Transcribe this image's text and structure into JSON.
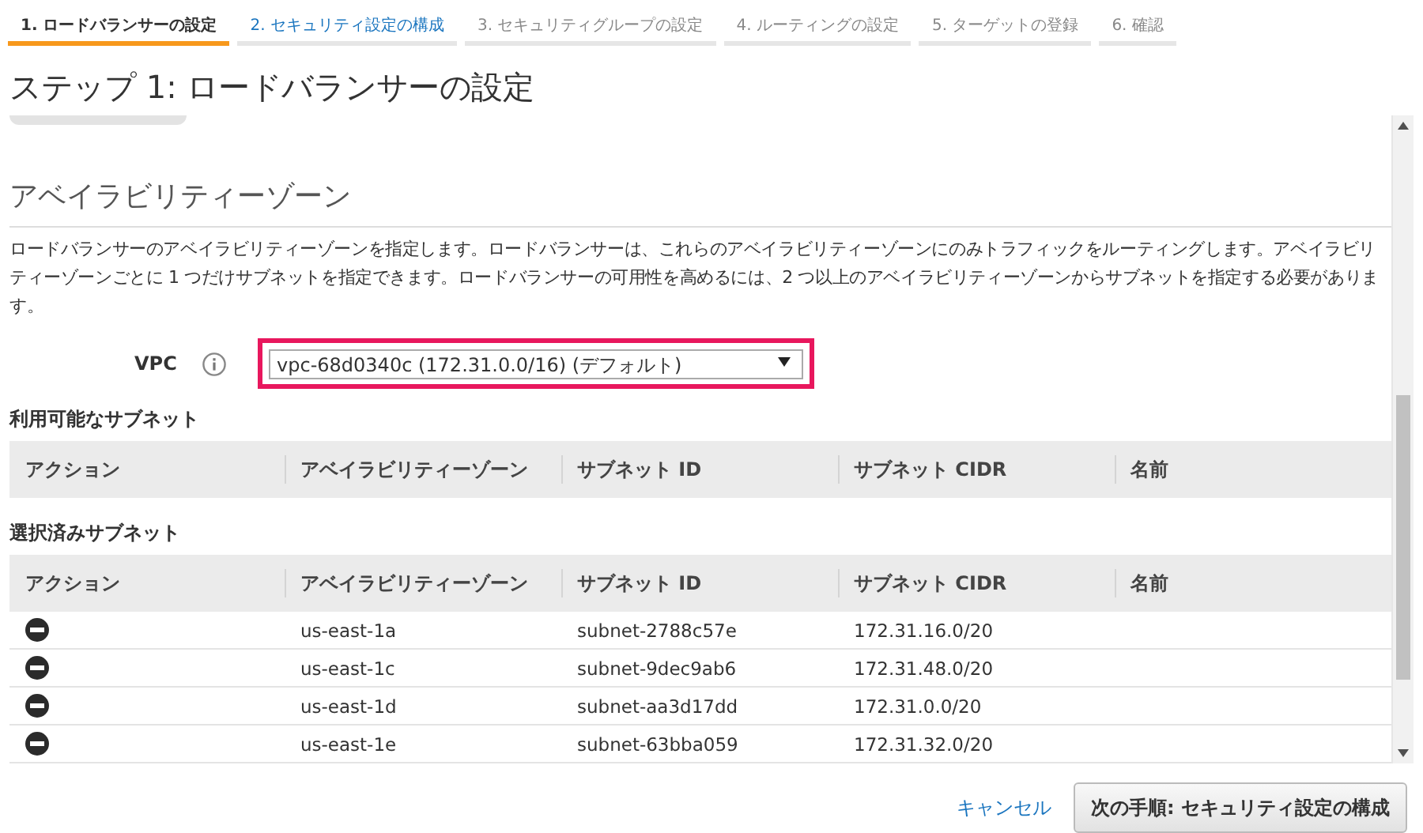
{
  "tabs": [
    {
      "label": "1. ロードバランサーの設定",
      "selected": true,
      "enabled": true
    },
    {
      "label": "2. セキュリティ設定の構成",
      "selected": false,
      "enabled": true
    },
    {
      "label": "3. セキュリティグループの設定",
      "selected": false,
      "enabled": false
    },
    {
      "label": "4. ルーティングの設定",
      "selected": false,
      "enabled": false
    },
    {
      "label": "5. ターゲットの登録",
      "selected": false,
      "enabled": false
    },
    {
      "label": "6. 確認",
      "selected": false,
      "enabled": false
    }
  ],
  "page_title": "ステップ 1: ロードバランサーの設定",
  "section": {
    "heading": "アベイラビリティーゾーン",
    "description": "ロードバランサーのアベイラビリティーゾーンを指定します。ロードバランサーは、これらのアベイラビリティーゾーンにのみトラフィックをルーティングします。アベイラビリティーゾーンごとに 1 つだけサブネットを指定できます。ロードバランサーの可用性を高めるには、2 つ以上のアベイラビリティーゾーンからサブネットを指定する必要があります。"
  },
  "vpc": {
    "label": "VPC",
    "value": "vpc-68d0340c (172.31.0.0/16) (デフォルト)",
    "highlighted": true
  },
  "available_subnets": {
    "title": "利用可能なサブネット",
    "columns": [
      "アクション",
      "アベイラビリティーゾーン",
      "サブネット ID",
      "サブネット CIDR",
      "名前"
    ]
  },
  "selected_subnets": {
    "title": "選択済みサブネット",
    "columns": [
      "アクション",
      "アベイラビリティーゾーン",
      "サブネット ID",
      "サブネット CIDR",
      "名前"
    ],
    "rows": [
      {
        "zone": "us-east-1a",
        "subnet_id": "subnet-2788c57e",
        "cidr": "172.31.16.0/20"
      },
      {
        "zone": "us-east-1c",
        "subnet_id": "subnet-9dec9ab6",
        "cidr": "172.31.48.0/20"
      },
      {
        "zone": "us-east-1d",
        "subnet_id": "subnet-aa3d17dd",
        "cidr": "172.31.0.0/20"
      },
      {
        "zone": "us-east-1e",
        "subnet_id": "subnet-63bba059",
        "cidr": "172.31.32.0/20"
      }
    ]
  },
  "footer": {
    "cancel": "キャンセル",
    "next": "次の手順: セキュリティ設定の構成"
  }
}
